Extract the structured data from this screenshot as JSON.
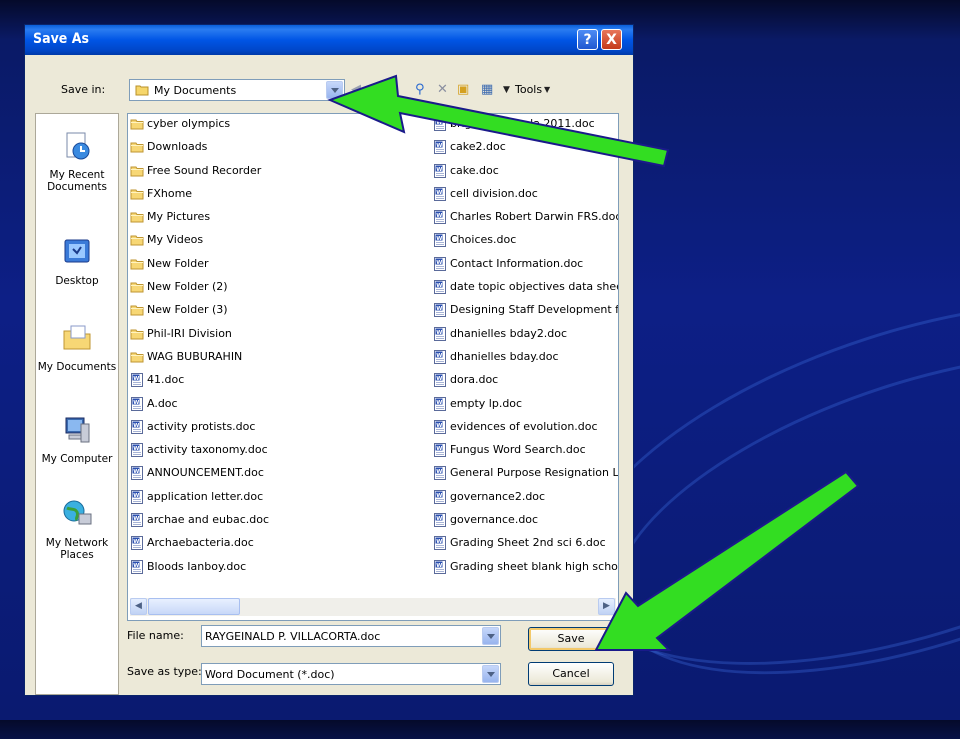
{
  "dialog": {
    "title": "Save As",
    "help_label": "?",
    "close_label": "X",
    "save_in_label": "Save in:",
    "save_in_value": "My Documents",
    "tools_label": "Tools",
    "file_name_label": "File name:",
    "file_name_value": "RAYGEINALD P. VILLACORTA.doc",
    "save_as_type_label": "Save as type:",
    "save_as_type_value": "Word Document (*.doc)",
    "save_button": "Save",
    "cancel_button": "Cancel"
  },
  "places": [
    {
      "label": "My Recent Documents",
      "icon": "recent-documents-icon"
    },
    {
      "label": "Desktop",
      "icon": "desktop-icon"
    },
    {
      "label": "My Documents",
      "icon": "my-documents-icon"
    },
    {
      "label": "My Computer",
      "icon": "my-computer-icon"
    },
    {
      "label": "My Network Places",
      "icon": "network-places-icon"
    }
  ],
  "files_left": [
    {
      "name": "cyber olympics",
      "type": "folder"
    },
    {
      "name": "Downloads",
      "type": "folder"
    },
    {
      "name": "Free Sound Recorder",
      "type": "folder"
    },
    {
      "name": "FXhome",
      "type": "folder"
    },
    {
      "name": "My Pictures",
      "type": "folder"
    },
    {
      "name": "My Videos",
      "type": "folder"
    },
    {
      "name": "New Folder",
      "type": "folder"
    },
    {
      "name": "New Folder (2)",
      "type": "folder"
    },
    {
      "name": "New Folder (3)",
      "type": "folder"
    },
    {
      "name": "Phil-IRI Division",
      "type": "folder"
    },
    {
      "name": "WAG BUBURAHIN",
      "type": "folder"
    },
    {
      "name": "41.doc",
      "type": "doc"
    },
    {
      "name": "A.doc",
      "type": "doc"
    },
    {
      "name": "activity protists.doc",
      "type": "doc"
    },
    {
      "name": "activity taxonomy.doc",
      "type": "doc"
    },
    {
      "name": "ANNOUNCEMENT.doc",
      "type": "doc"
    },
    {
      "name": "application letter.doc",
      "type": "doc"
    },
    {
      "name": "archae and eubac.doc",
      "type": "doc"
    },
    {
      "name": "Archaebacteria.doc",
      "type": "doc"
    },
    {
      "name": "Bloods Ianboy.doc",
      "type": "doc"
    }
  ],
  "files_right": [
    {
      "name": "brigada eskwela 2011.doc",
      "type": "doc"
    },
    {
      "name": "cake2.doc",
      "type": "doc"
    },
    {
      "name": "cake.doc",
      "type": "doc"
    },
    {
      "name": "cell division.doc",
      "type": "doc"
    },
    {
      "name": "Charles Robert Darwin FRS.doc",
      "type": "doc"
    },
    {
      "name": "Choices.doc",
      "type": "doc"
    },
    {
      "name": "Contact Information.doc",
      "type": "doc"
    },
    {
      "name": "date topic objectives data sheet.doc",
      "type": "doc"
    },
    {
      "name": "Designing Staff Development for the",
      "type": "doc"
    },
    {
      "name": "dhanielles bday2.doc",
      "type": "doc"
    },
    {
      "name": "dhanielles bday.doc",
      "type": "doc"
    },
    {
      "name": "dora.doc",
      "type": "doc"
    },
    {
      "name": "empty lp.doc",
      "type": "doc"
    },
    {
      "name": "evidences of evolution.doc",
      "type": "doc"
    },
    {
      "name": "Fungus Word Search.doc",
      "type": "doc"
    },
    {
      "name": "General Purpose Resignation Letter",
      "type": "doc"
    },
    {
      "name": "governance2.doc",
      "type": "doc"
    },
    {
      "name": "governance.doc",
      "type": "doc"
    },
    {
      "name": "Grading Sheet 2nd sci 6.doc",
      "type": "doc"
    },
    {
      "name": "Grading sheet blank high school.doc",
      "type": "doc"
    }
  ],
  "colors": {
    "titlebar": "#0055e5",
    "arrow_green": "#33dd22",
    "background_blue": "#0d1f86"
  }
}
